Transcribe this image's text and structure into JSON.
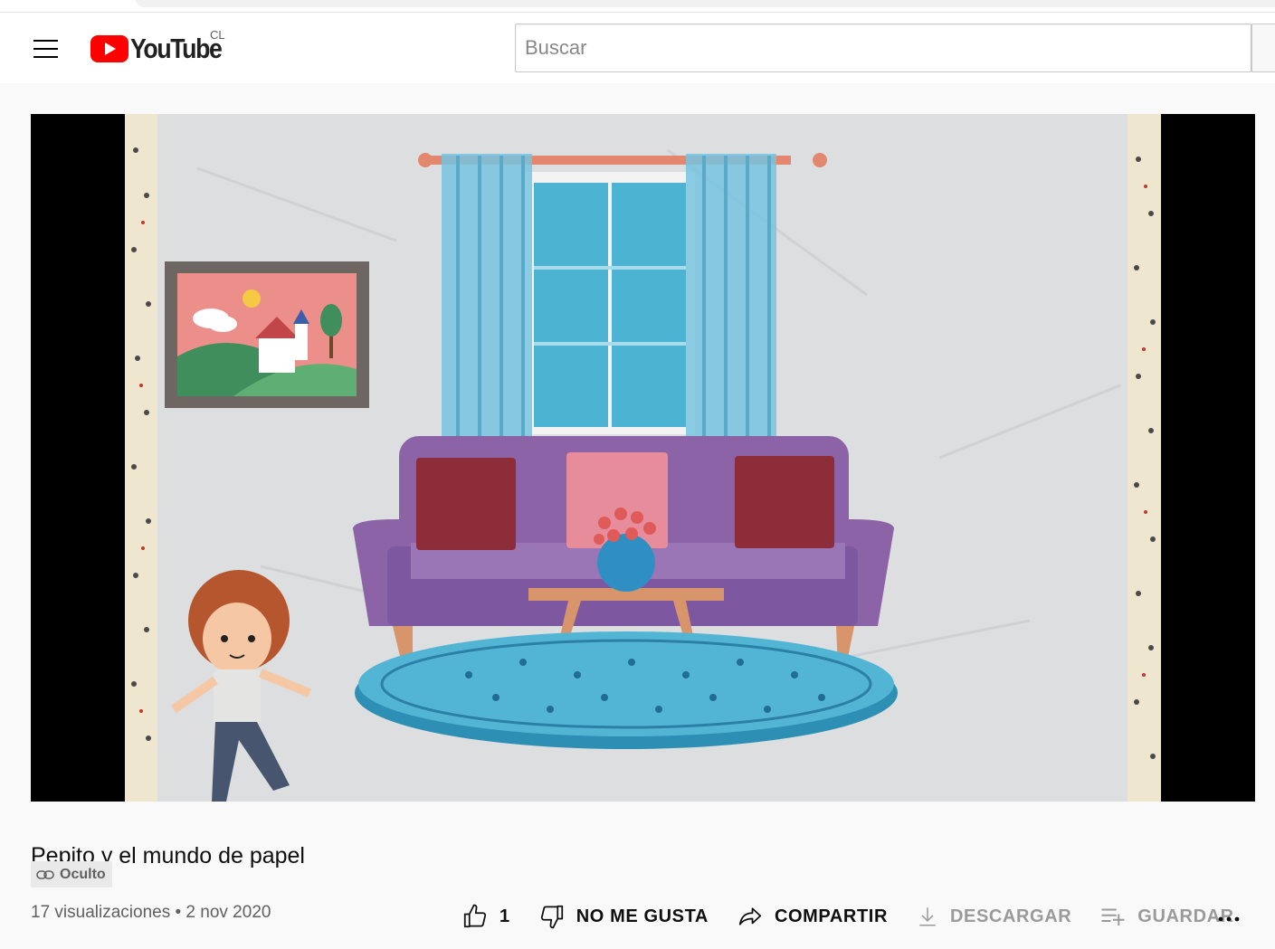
{
  "masthead": {
    "logo_text": "YouTube",
    "country_code": "CL",
    "search_placeholder": "Buscar"
  },
  "video": {
    "title": "Pepito y el mundo de papel",
    "visibility_badge": "Oculto",
    "views": "17 visualizaciones",
    "separator": "•",
    "date": "2 nov 2020"
  },
  "actions": {
    "like_count": "1",
    "dislike_label": "NO ME GUSTA",
    "share_label": "COMPARTIR",
    "download_label": "DESCARGAR",
    "save_label": "GUARDAR"
  },
  "colors": {
    "brand_red": "#ff0000",
    "disabled_text": "#9a9a9a",
    "meta_text": "#606060"
  },
  "icons": [
    "menu-icon",
    "youtube-logo-icon",
    "link-icon",
    "thumbs-up-icon",
    "thumbs-down-icon",
    "share-icon",
    "download-icon",
    "playlist-add-icon",
    "more-options-icon"
  ]
}
